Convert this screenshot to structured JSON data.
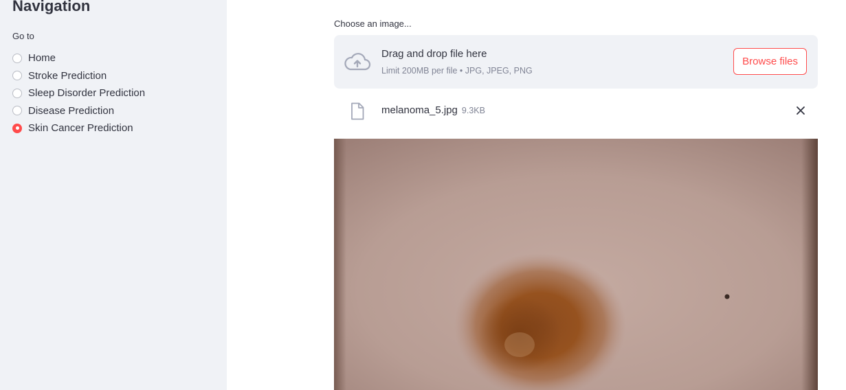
{
  "sidebar": {
    "title": "Navigation",
    "goto_label": "Go to",
    "items": [
      {
        "label": "Home",
        "selected": false
      },
      {
        "label": "Stroke Prediction",
        "selected": false
      },
      {
        "label": "Sleep Disorder Prediction",
        "selected": false
      },
      {
        "label": "Disease Prediction",
        "selected": false
      },
      {
        "label": "Skin Cancer Prediction",
        "selected": true
      }
    ]
  },
  "uploader": {
    "label": "Choose an image...",
    "drop_title": "Drag and drop file here",
    "limit_text": "Limit 200MB per file • JPG, JPEG, PNG",
    "browse_label": "Browse files",
    "icon": "cloud-upload-icon"
  },
  "file": {
    "name": "melanoma_5.jpg",
    "size": "9.3KB",
    "icon": "file-icon",
    "remove_icon": "close-icon"
  },
  "colors": {
    "accent": "#ff4b4b",
    "sidebar_bg": "#f0f2f6",
    "text": "#31333f",
    "muted": "#808495"
  }
}
